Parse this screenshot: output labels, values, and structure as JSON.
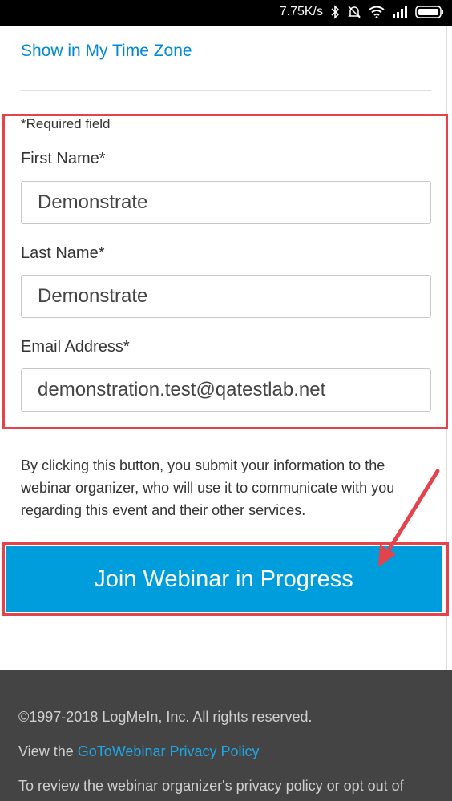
{
  "status_bar": {
    "network_speed": "7.75K/s",
    "icons": [
      "bluetooth-icon",
      "mute-icon",
      "wifi-icon",
      "signal-icon",
      "battery-icon"
    ]
  },
  "timezone_link": "Show in My Time Zone",
  "required_note": "*Required field",
  "form": {
    "first_name": {
      "label": "First Name*",
      "value": "Demonstrate"
    },
    "last_name": {
      "label": "Last Name*",
      "value": "Demonstrate"
    },
    "email": {
      "label": "Email Address*",
      "value": "demonstration.test@qatestlab.net"
    }
  },
  "notice": "By clicking this button, you submit your information to the webinar organizer, who will use it to communicate with you regarding this event and their other services.",
  "join_button": "Join Webinar in Progress",
  "footer": {
    "copyright": "©1997-2018 LogMeIn, Inc. All rights reserved.",
    "privacy_prefix": "View the",
    "privacy_link": "GoToWebinar Privacy Policy",
    "review_text": "To review the webinar organizer's privacy policy or opt out of"
  },
  "colors": {
    "accent": "#009ddc",
    "link": "#0089d2",
    "highlight": "#e4434c",
    "footer_bg": "#444444"
  }
}
